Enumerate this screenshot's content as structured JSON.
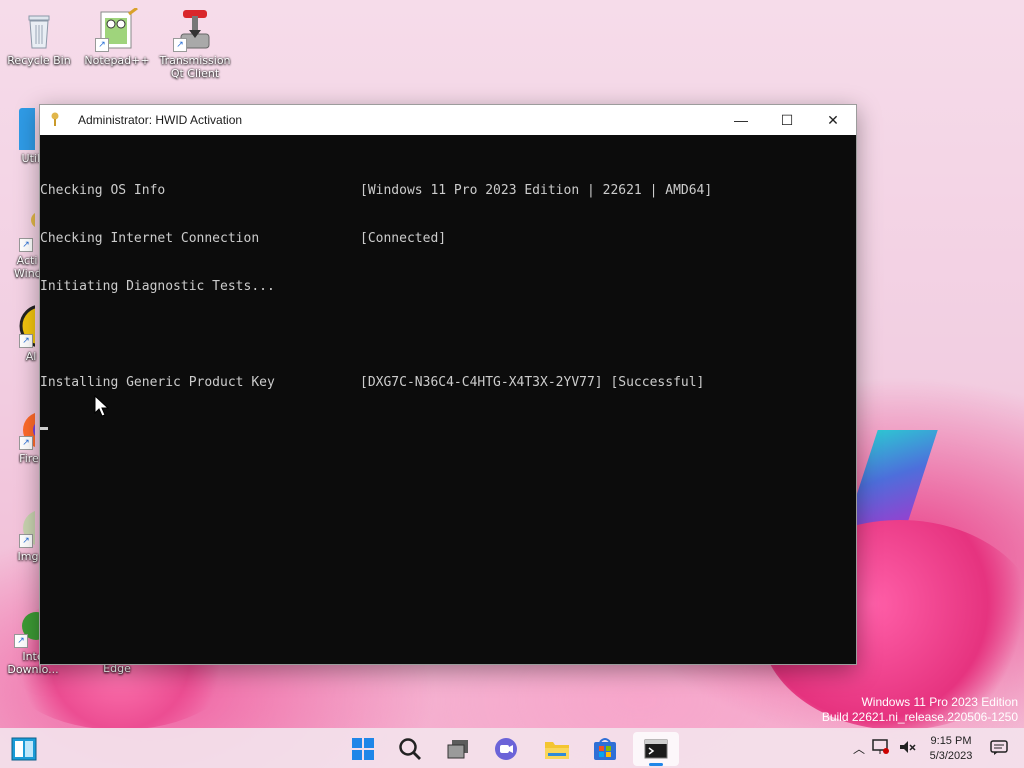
{
  "desktop": {
    "icons": [
      {
        "label": "Recycle Bin",
        "icon": "recycle-bin-icon"
      },
      {
        "label": "Notepad++",
        "icon": "notepad-plus-plus-icon"
      },
      {
        "label": "Transmission Qt Client",
        "icon": "transmission-icon"
      },
      {
        "label": "Util",
        "icon": "folder-icon"
      },
      {
        "label": "Acti Wind",
        "icon": "key-icon"
      },
      {
        "label": "Al",
        "icon": "aimp-icon"
      },
      {
        "label": "Fire",
        "icon": "firefox-icon"
      },
      {
        "label": "Img",
        "icon": "imgburn-icon"
      },
      {
        "label": "Inte Downlo...",
        "icon": "idm-icon"
      },
      {
        "label": "Edge",
        "icon": "edge-icon"
      }
    ]
  },
  "window": {
    "title": "Administrator:  HWID Activation",
    "controls": {
      "minimize": "—",
      "maximize": "☐",
      "close": "✕"
    },
    "lines": [
      {
        "left": "Checking OS Info",
        "right": "[Windows 11 Pro 2023 Edition | 22621 | AMD64]"
      },
      {
        "left": "Checking Internet Connection",
        "right": "[Connected]"
      },
      {
        "left": "Initiating Diagnostic Tests...",
        "right": ""
      },
      {
        "left": "",
        "right": ""
      },
      {
        "left": "Installing Generic Product Key",
        "right": "[DXG7C-N36C4-C4HTG-X4T3X-2YV77] [Successful]"
      }
    ]
  },
  "watermark": {
    "line1": "Windows 11 Pro 2023 Edition",
    "line2": "Build 22621.ni_release.220506-1250"
  },
  "taskbar": {
    "time": "9:15 PM",
    "date": "5/3/2023",
    "items": [
      "start-icon",
      "search-icon",
      "task-view-icon",
      "teams-chat-icon",
      "file-explorer-icon",
      "store-icon",
      "terminal-icon"
    ]
  }
}
